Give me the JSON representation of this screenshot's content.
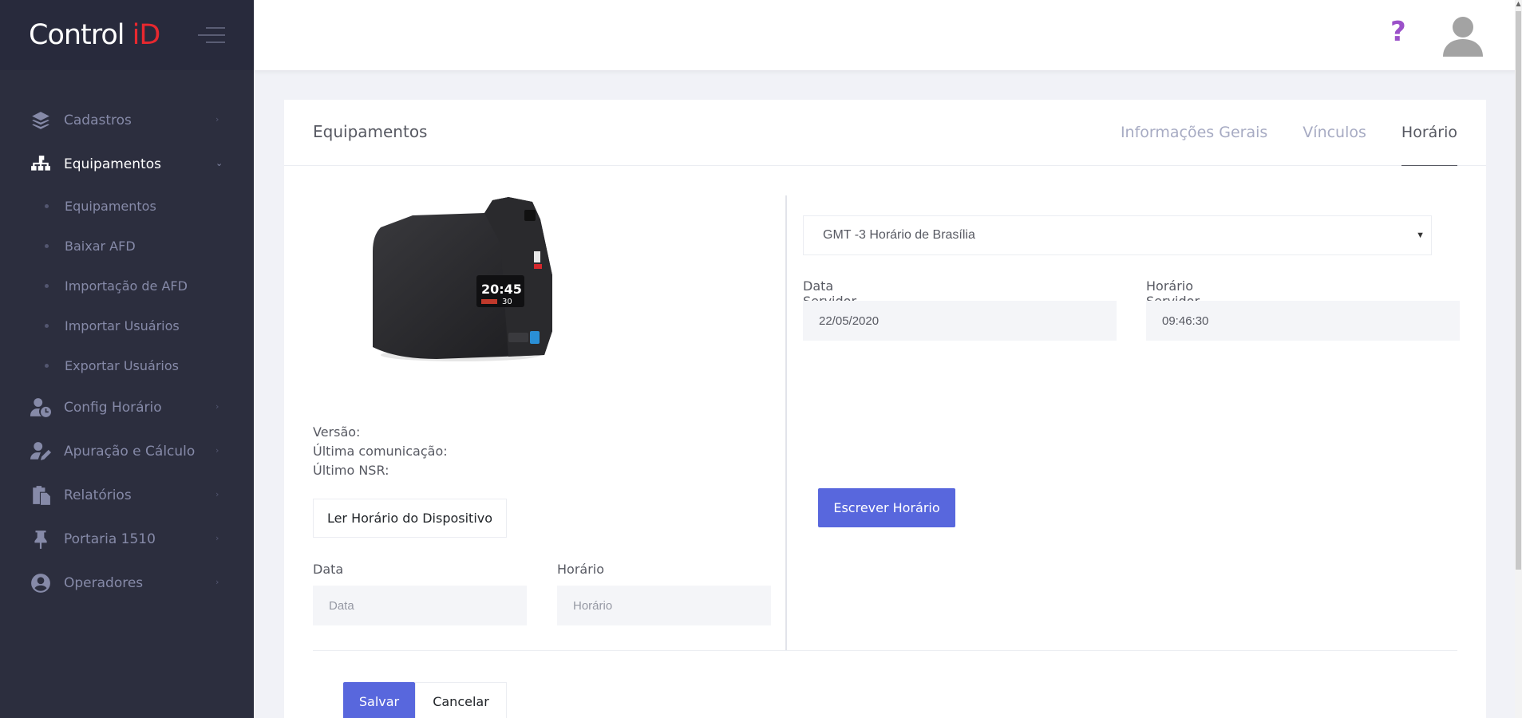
{
  "brand": {
    "text_main": "Control ",
    "text_accent": "iD"
  },
  "sidebar": {
    "items": [
      {
        "label": "Cadastros",
        "icon": "layers-icon"
      },
      {
        "label": "Equipamentos",
        "icon": "sitemap-icon",
        "active": true
      },
      {
        "label": "Config Horário",
        "icon": "user-clock-icon"
      },
      {
        "label": "Apuração e Cálculo",
        "icon": "user-edit-icon"
      },
      {
        "label": "Relatórios",
        "icon": "paste-icon"
      },
      {
        "label": "Portaria 1510",
        "icon": "thumbtack-icon"
      },
      {
        "label": "Operadores",
        "icon": "user-circle-icon"
      }
    ],
    "submenu": [
      "Equipamentos",
      "Baixar AFD",
      "Importação de AFD",
      "Importar Usuários",
      "Exportar Usuários"
    ]
  },
  "topbar": {
    "help": "?"
  },
  "card": {
    "title": "Equipamentos",
    "tabs": [
      "Informações Gerais",
      "Vínculos",
      "Horário"
    ]
  },
  "device": {
    "version_label": "Versão:",
    "last_comm_label": "Última comunicação:",
    "last_nsr_label": "Último NSR:",
    "screen_time": "20:45",
    "screen_num": "30"
  },
  "left": {
    "read_button": "Ler Horário do Dispositivo",
    "date_label": "Data",
    "date_placeholder": "Data",
    "time_label": "Horário",
    "time_placeholder": "Horário"
  },
  "right": {
    "timezone": "GMT -3 Horário de Brasília",
    "server_date_label": "Data Servidor",
    "server_date_value": "22/05/2020",
    "server_time_label": "Horário Servidor",
    "server_time_value": "09:46:30",
    "write_button": "Escrever Horário"
  },
  "footer": {
    "save": "Salvar",
    "cancel": "Cancelar"
  },
  "colors": {
    "primary": "#5867dd",
    "sidebar": "#2c2e3e",
    "accent_red": "#e8282f",
    "help": "#9b51c9"
  }
}
